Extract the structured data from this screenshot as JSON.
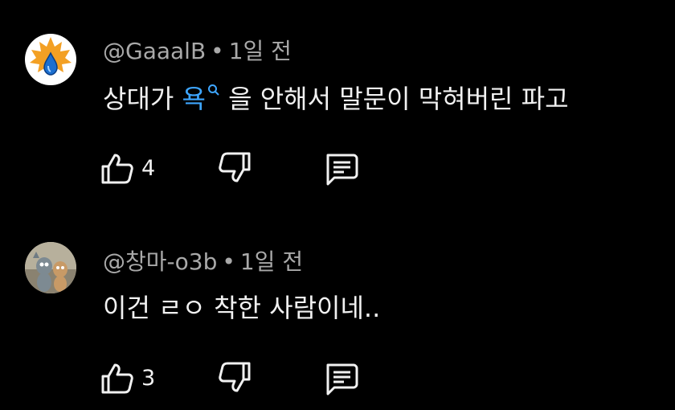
{
  "colors": {
    "background": "#000000",
    "text": "#f1f1f1",
    "meta": "#a9a9a9",
    "link": "#3ea6ff"
  },
  "comments": [
    {
      "author": "@GaaalB",
      "separator": "•",
      "time": "1일 전",
      "text_before": "상대가 ",
      "search_term": "욕",
      "text_after": " 을 안해서 말문이 막혀버린 파고",
      "like_count": "4",
      "avatar_icon": "maple-leaf-water-drop-avatar"
    },
    {
      "author": "@창마-o3b",
      "separator": "•",
      "time": "1일 전",
      "text": "이건 ㄹㅇ 착한 사람이네..",
      "like_count": "3",
      "avatar_icon": "cartoon-characters-avatar"
    }
  ],
  "icons": {
    "like": "thumbs-up-icon",
    "dislike": "thumbs-down-icon",
    "reply": "comment-icon",
    "search": "search-icon"
  }
}
